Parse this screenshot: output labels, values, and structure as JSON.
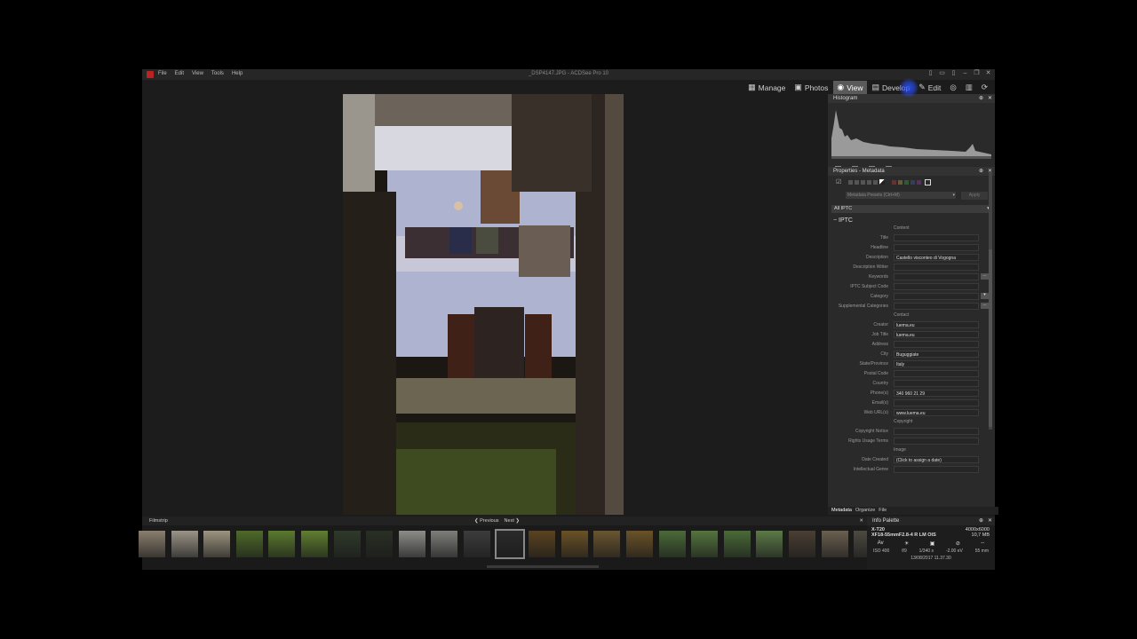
{
  "window": {
    "title": "_DSP4147.JPG - ACDSee Pro 10",
    "menu": [
      "File",
      "Edit",
      "View",
      "Tools",
      "Help"
    ]
  },
  "modes": [
    {
      "label": "Manage",
      "icon": "grid-icon",
      "active": false
    },
    {
      "label": "Photos",
      "icon": "photos-icon",
      "active": false
    },
    {
      "label": "View",
      "icon": "eye-icon",
      "active": true
    },
    {
      "label": "Develop",
      "icon": "develop-icon",
      "active": false
    },
    {
      "label": "Edit",
      "icon": "edit-icon",
      "active": false
    }
  ],
  "histogram": {
    "title": "Histogram",
    "channels": [
      "R",
      "G",
      "B",
      "L"
    ]
  },
  "properties": {
    "title": "Properties - Metadata",
    "preset_placeholder": "Metadata Presets (Ctrl+M)",
    "apply_label": "Apply",
    "view_select": "All IPTC",
    "section": "IPTC",
    "groups": [
      {
        "name": "Content",
        "fields": [
          {
            "label": "Title",
            "value": ""
          },
          {
            "label": "Headline",
            "value": ""
          },
          {
            "label": "Description",
            "value": "Castello visconteo di Vogogna"
          },
          {
            "label": "Description Writer",
            "value": ""
          },
          {
            "label": "Keywords",
            "value": "",
            "more": "..."
          },
          {
            "label": "IPTC Subject Code",
            "value": ""
          },
          {
            "label": "Category",
            "value": "",
            "dropdown": true
          },
          {
            "label": "Supplemental Categories",
            "value": "",
            "more": "..."
          }
        ]
      },
      {
        "name": "Contact",
        "fields": [
          {
            "label": "Creator",
            "value": "luema.eu"
          },
          {
            "label": "Job Title",
            "value": "luema.eu"
          },
          {
            "label": "Address",
            "value": ""
          },
          {
            "label": "City",
            "value": "Buguggiate"
          },
          {
            "label": "State/Province",
            "value": "Italy"
          },
          {
            "label": "Postal Code",
            "value": ""
          },
          {
            "label": "Country",
            "value": ""
          },
          {
            "label": "Phone(s)",
            "value": "340 960 21 29"
          },
          {
            "label": "Email(s)",
            "value": ""
          },
          {
            "label": "Web URL(s)",
            "value": "www.luema.eu"
          }
        ]
      },
      {
        "name": "Copyright",
        "fields": [
          {
            "label": "Copyright Notice",
            "value": ""
          },
          {
            "label": "Rights Usage Terms",
            "value": ""
          }
        ]
      },
      {
        "name": "Image",
        "fields": [
          {
            "label": "Date Created",
            "value": "(Click to assign a date)"
          },
          {
            "label": "Intellectual Genre",
            "value": ""
          }
        ]
      }
    ],
    "tabs": [
      "Metadata",
      "Organize",
      "File"
    ]
  },
  "filmstrip": {
    "title": "Filmstrip",
    "prev_label": "Previous",
    "next_label": "Next",
    "selected_index": 11,
    "thumb_colors": [
      "#8a7f6e",
      "#9a9488",
      "#9c9480",
      "#4f6a2a",
      "#5a7a2e",
      "#5f7f30",
      "#2f3a2a",
      "#2a2f24",
      "#8c8c88",
      "#7e7e7a",
      "#3c3c3c",
      "#2a2a2a",
      "#5a4320",
      "#6a5226",
      "#6a5530",
      "#6b5228",
      "#4b6a3a",
      "#55743f",
      "#4a6a38",
      "#5c7a48",
      "#4a3f34",
      "#6a6050",
      "#4d4a40"
    ]
  },
  "info_palette": {
    "title": "Info Palette",
    "camera": "X-T20",
    "dimensions": "4000x6000",
    "lens": "XF18-55mmF2.8-4 R LM OIS",
    "filesize": "10,7 MB",
    "icons": [
      "Av",
      "☀",
      "▣",
      "⊘",
      "--"
    ],
    "iso": "ISO 400",
    "aperture": "f/9",
    "shutter": "1/340 s",
    "ev": "-2.00 eV",
    "focal": "55 mm",
    "datetime": "13/08/2017 11.37.30"
  }
}
